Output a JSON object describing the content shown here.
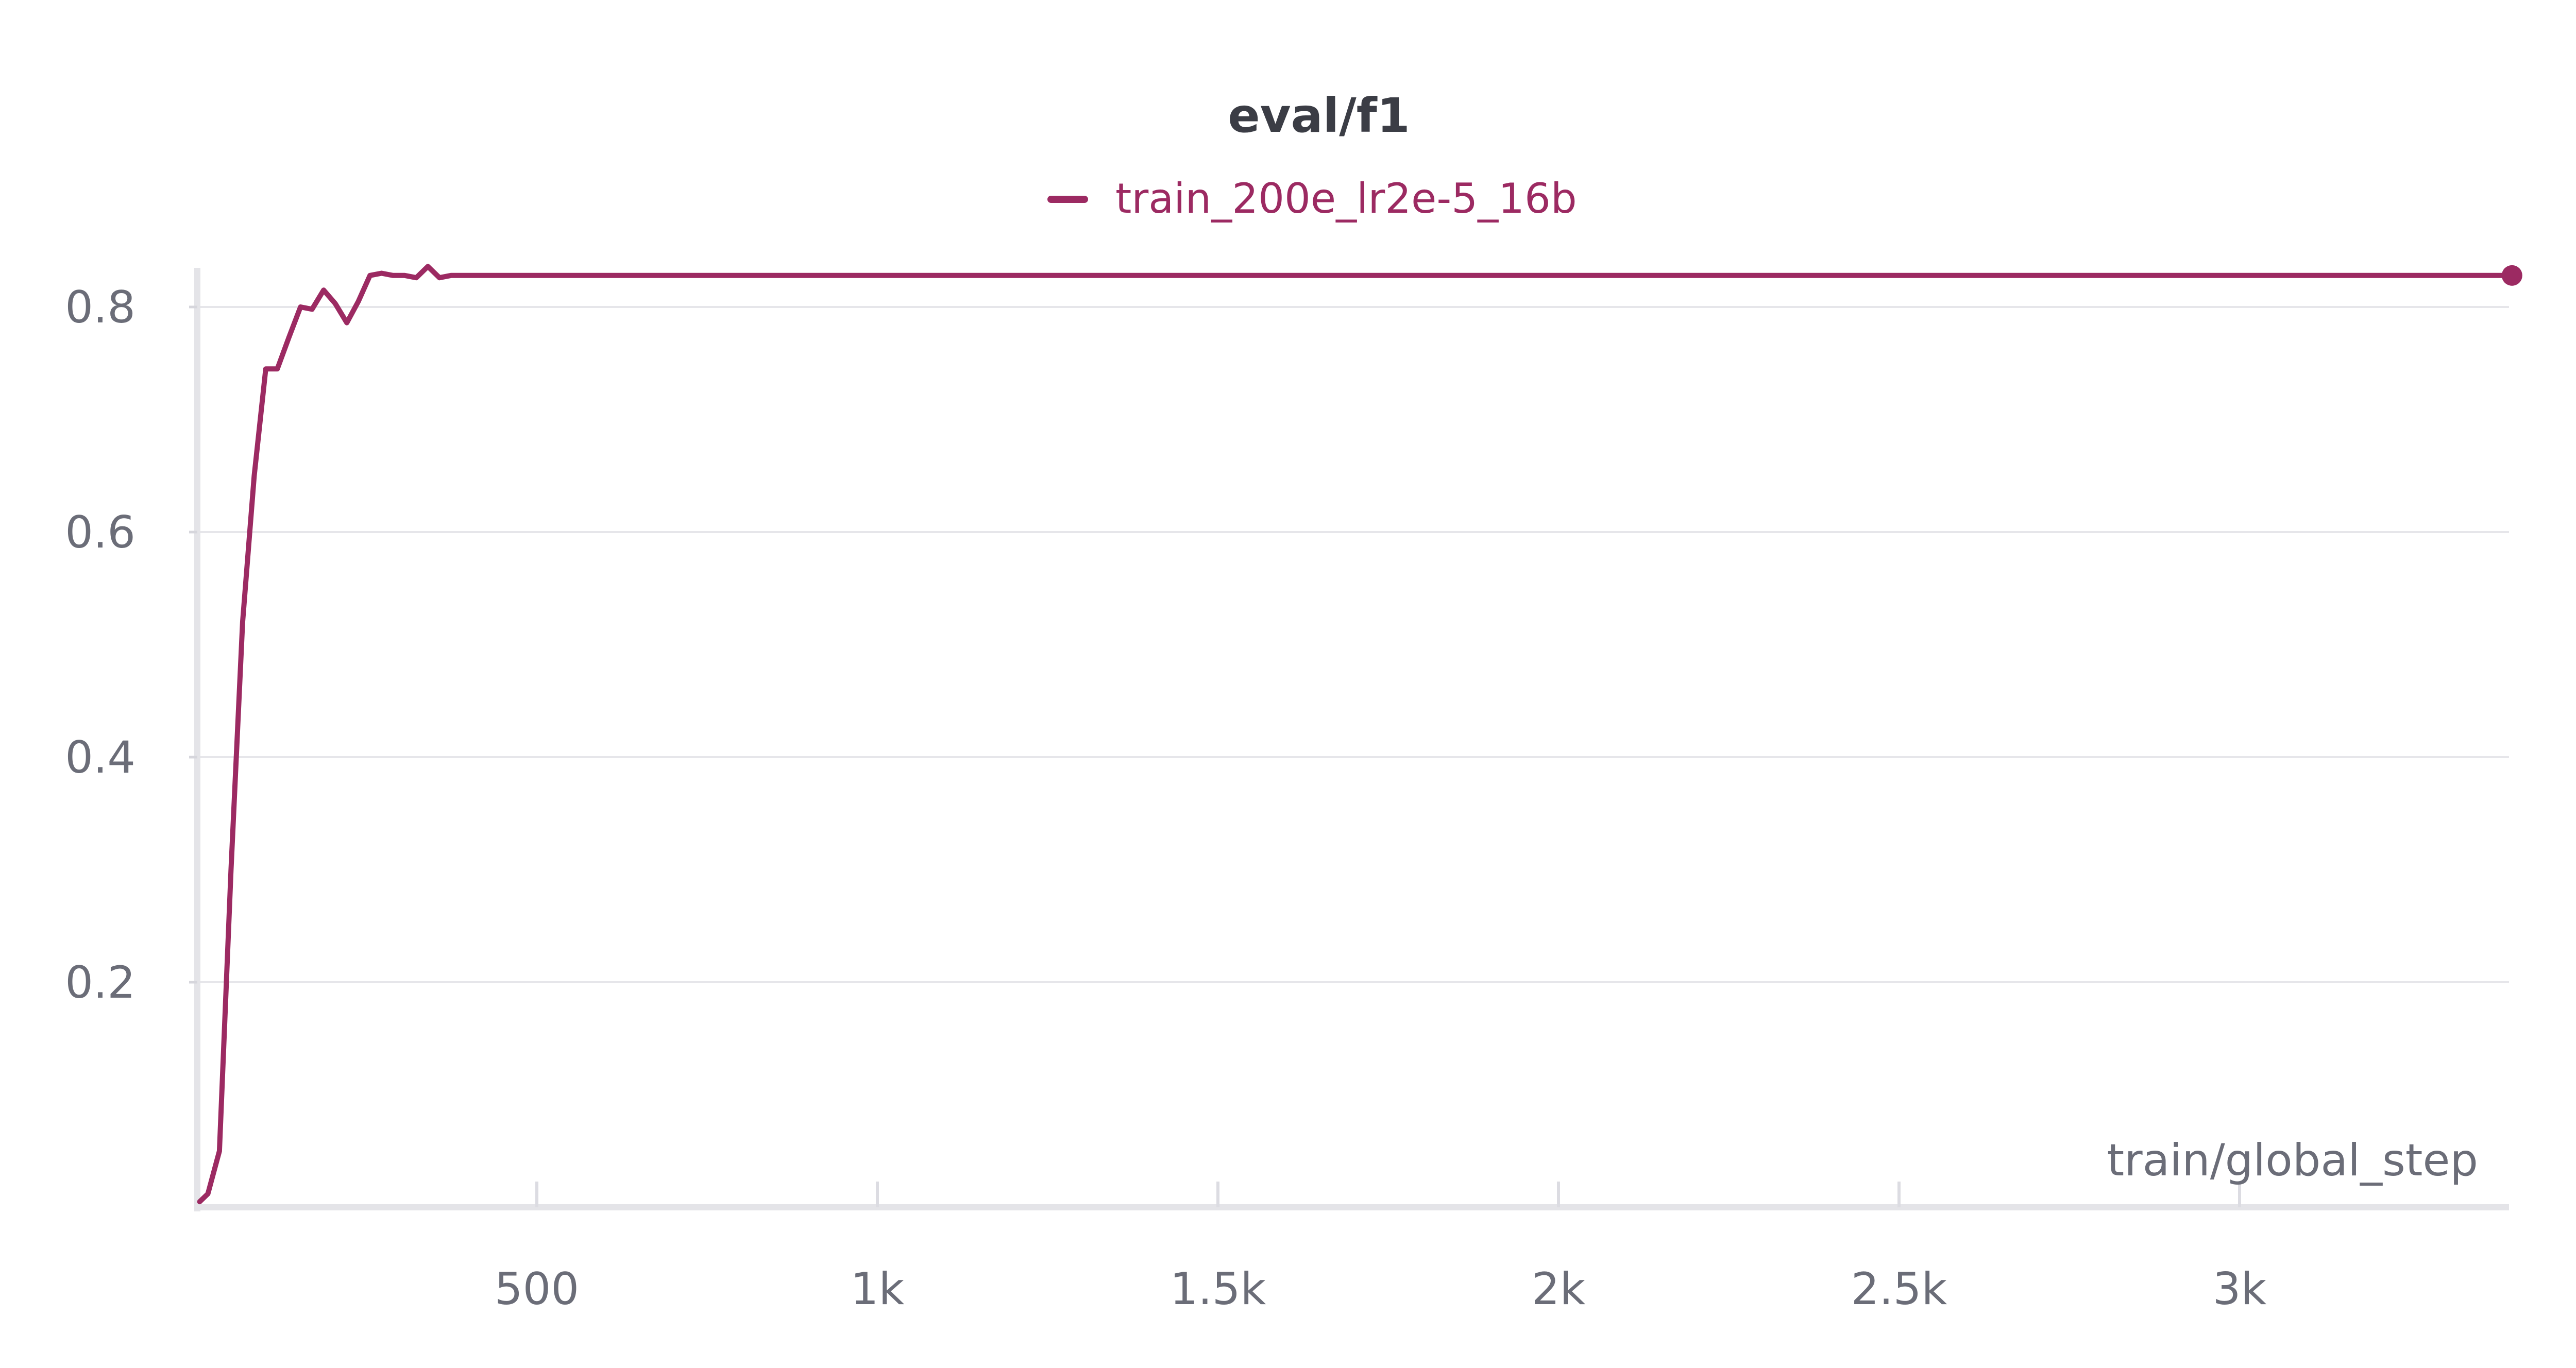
{
  "chart_data": {
    "type": "line",
    "title": "eval/f1",
    "xlabel": "train/global_step",
    "ylabel": "",
    "xlim": [
      0,
      3400
    ],
    "ylim": [
      0,
      0.8
    ],
    "grid": true,
    "legend_position": "top-center",
    "x_ticks": [
      {
        "value": 500,
        "label": "500"
      },
      {
        "value": 1000,
        "label": "1k"
      },
      {
        "value": 1500,
        "label": "1.5k"
      },
      {
        "value": 2000,
        "label": "2k"
      },
      {
        "value": 2500,
        "label": "2.5k"
      },
      {
        "value": 3000,
        "label": "3k"
      }
    ],
    "y_ticks": [
      {
        "value": 0.2,
        "label": "0.2"
      },
      {
        "value": 0.4,
        "label": "0.4"
      },
      {
        "value": 0.6,
        "label": "0.6"
      },
      {
        "value": 0.8,
        "label": "0.8"
      }
    ],
    "series": [
      {
        "name": "train_200e_lr2e-5_16b",
        "color": "#9c2a62",
        "end_marker": true,
        "points": [
          [
            5,
            0.005
          ],
          [
            17,
            0.012
          ],
          [
            34,
            0.05
          ],
          [
            51,
            0.3
          ],
          [
            68,
            0.52
          ],
          [
            85,
            0.65
          ],
          [
            102,
            0.745
          ],
          [
            119,
            0.745
          ],
          [
            136,
            0.773
          ],
          [
            153,
            0.8
          ],
          [
            170,
            0.798
          ],
          [
            187,
            0.815
          ],
          [
            204,
            0.803
          ],
          [
            221,
            0.786
          ],
          [
            238,
            0.805
          ],
          [
            255,
            0.828
          ],
          [
            272,
            0.83
          ],
          [
            289,
            0.828
          ],
          [
            306,
            0.828
          ],
          [
            323,
            0.826
          ],
          [
            340,
            0.836
          ],
          [
            357,
            0.826
          ],
          [
            374,
            0.828
          ],
          [
            391,
            0.828
          ],
          [
            3400,
            0.828
          ]
        ]
      }
    ]
  }
}
